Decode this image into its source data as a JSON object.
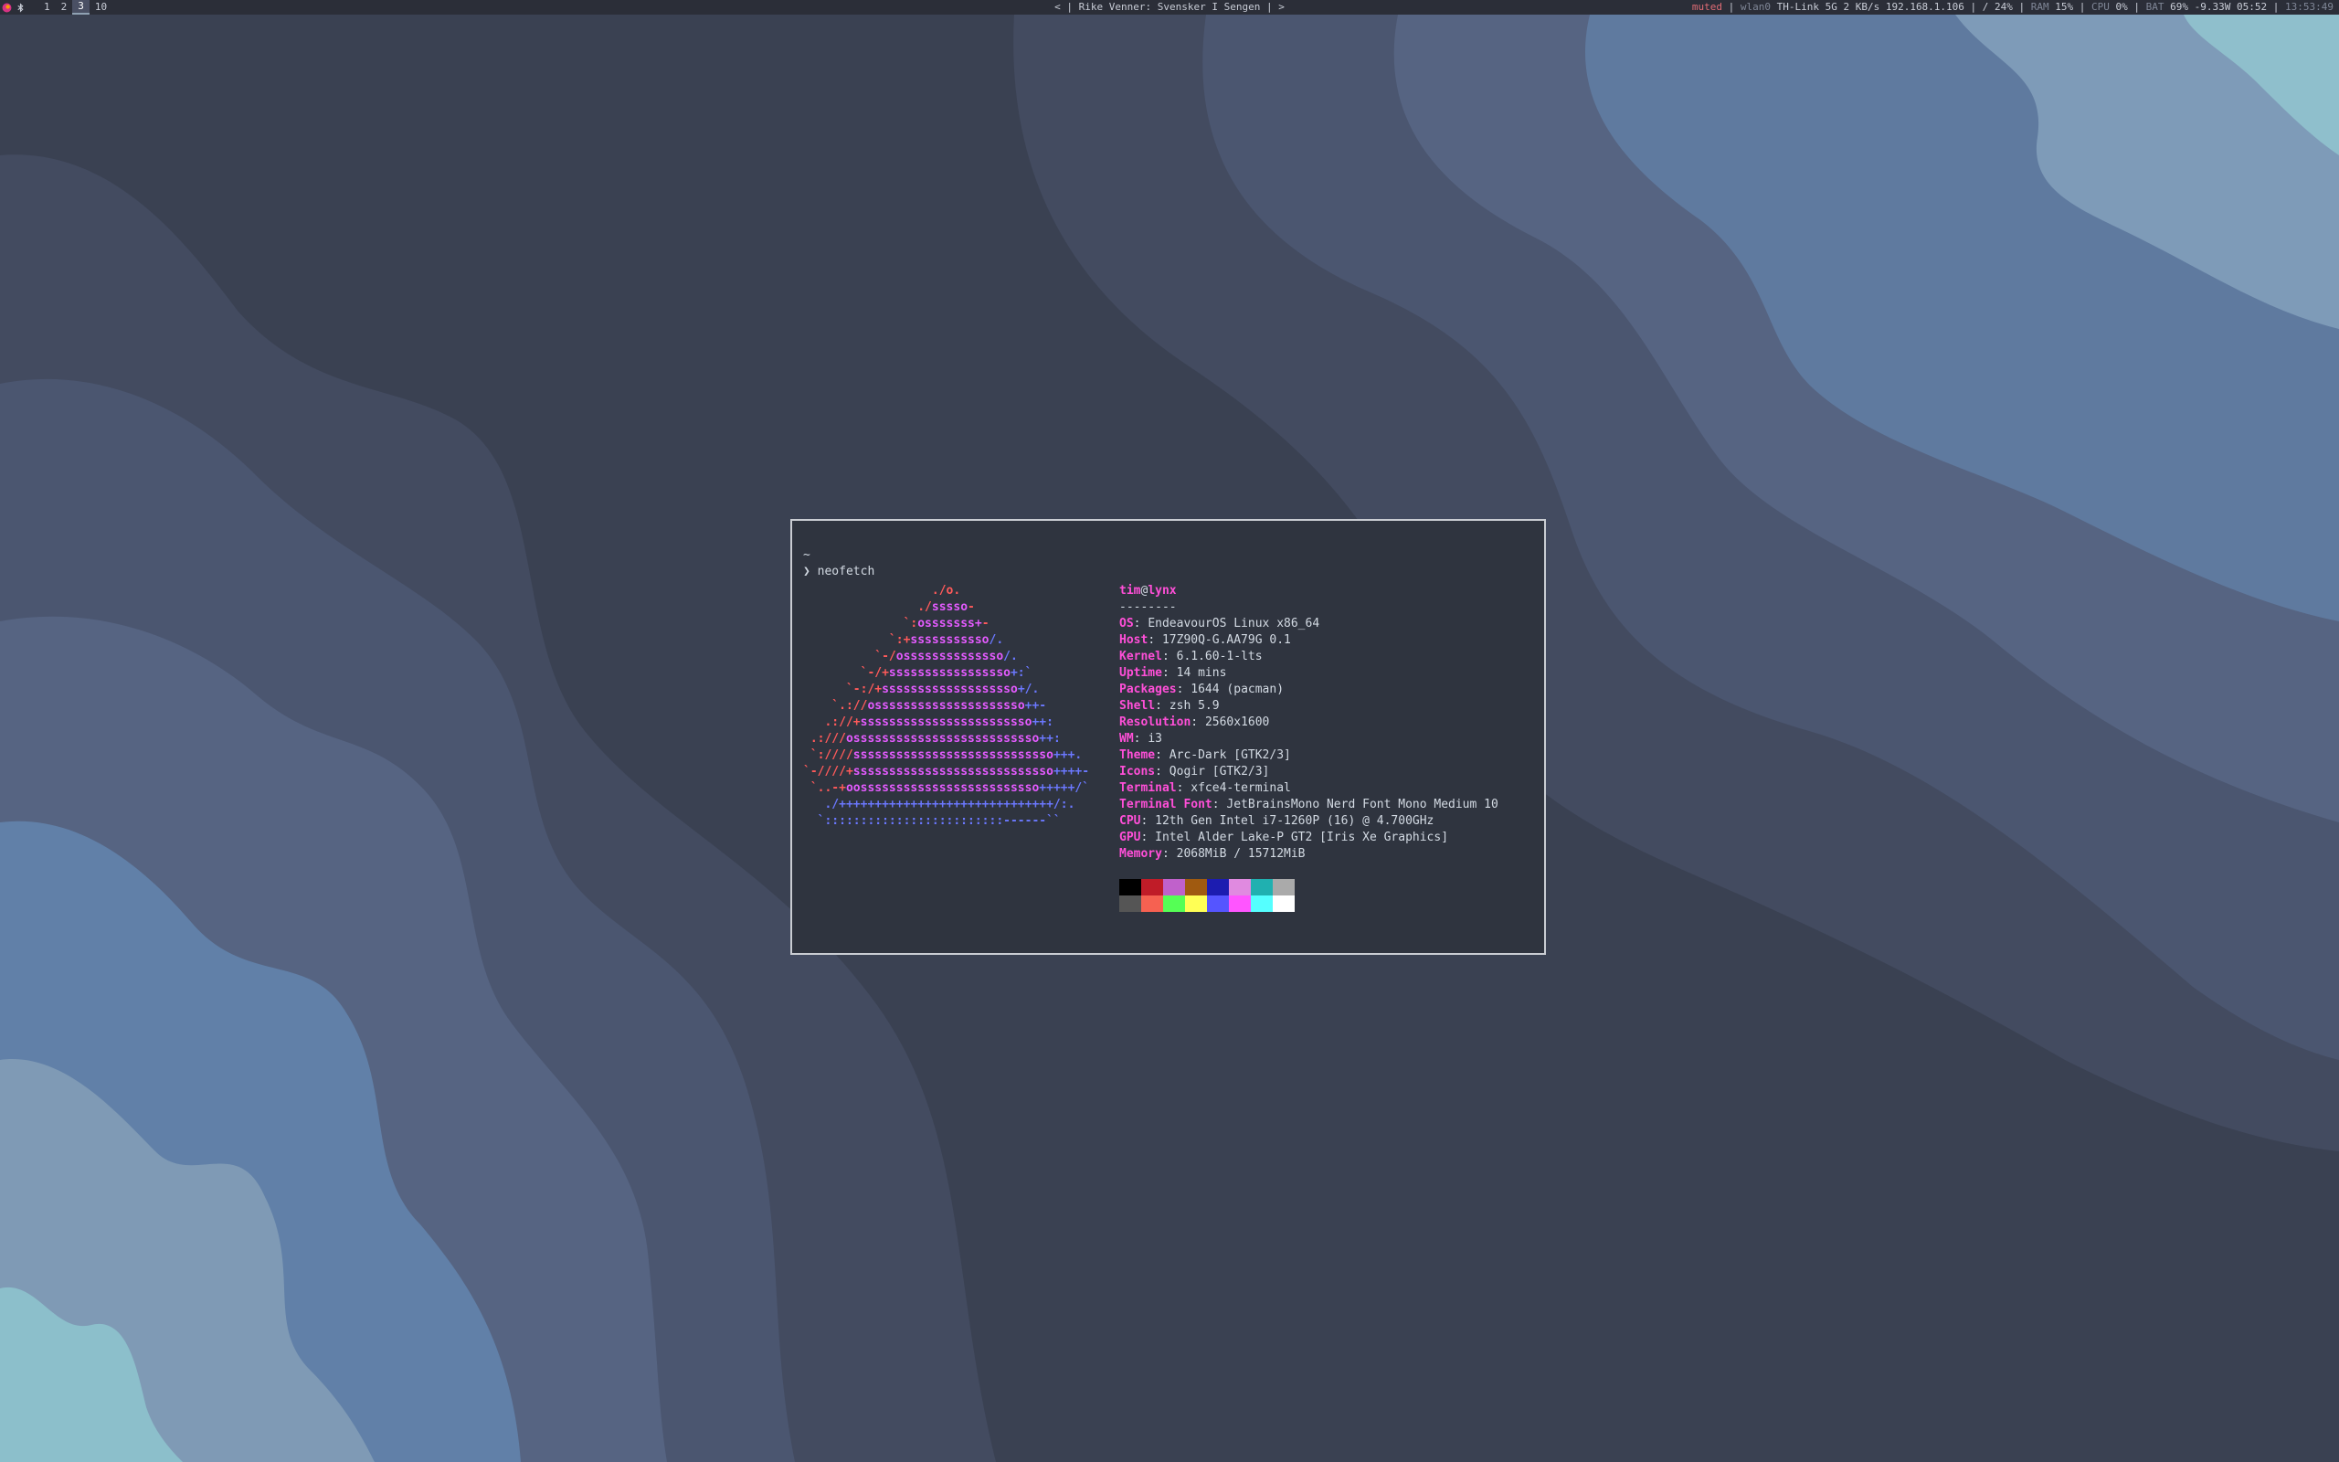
{
  "topbar": {
    "workspaces": [
      "1",
      "2",
      "3",
      "10"
    ],
    "active_workspace": "3",
    "media": "< | Rike Venner: Svensker I Sengen | >",
    "status": {
      "audio": "muted",
      "wlan_if": "wlan0",
      "ssid": "TH-Link 5G",
      "net": "2 KB/s 192.168.1.106",
      "disk": "/ 24%",
      "ram_label": "RAM",
      "ram": "15%",
      "cpu_label": "CPU",
      "cpu": "0%",
      "bat_label": "BAT",
      "bat": "69% -9.33W 05:52",
      "time": "13:53:49"
    }
  },
  "terminal": {
    "cwd": "~",
    "prompt": "❯",
    "command": "neofetch",
    "art_lines": [
      [
        [
          "red",
          "                  ./o."
        ]
      ],
      [
        [
          "red",
          "                ./"
        ],
        [
          "mag",
          "sssso"
        ],
        [
          "red",
          "-"
        ]
      ],
      [
        [
          "red",
          "              `:"
        ],
        [
          "mag",
          "osssssss+"
        ],
        [
          "red",
          "-"
        ]
      ],
      [
        [
          "red",
          "            `:+"
        ],
        [
          "mag",
          "sssssssssso"
        ],
        [
          "blue",
          "/."
        ]
      ],
      [
        [
          "red",
          "          `-/"
        ],
        [
          "mag",
          "ossssssssssssso"
        ],
        [
          "blue",
          "/."
        ]
      ],
      [
        [
          "red",
          "        `-/+"
        ],
        [
          "mag",
          "sssssssssssssssso"
        ],
        [
          "blue",
          "+:`"
        ]
      ],
      [
        [
          "red",
          "      `-:/+"
        ],
        [
          "mag",
          "sssssssssssssssssso"
        ],
        [
          "blue",
          "+/."
        ]
      ],
      [
        [
          "red",
          "    `.://"
        ],
        [
          "mag",
          "osssssssssssssssssssso"
        ],
        [
          "blue",
          "++-"
        ]
      ],
      [
        [
          "red",
          "   .://+"
        ],
        [
          "mag",
          "ssssssssssssssssssssssso"
        ],
        [
          "blue",
          "++:"
        ]
      ],
      [
        [
          "red",
          " .:///"
        ],
        [
          "mag",
          "ossssssssssssssssssssssssso"
        ],
        [
          "blue",
          "++:"
        ]
      ],
      [
        [
          "red",
          " `:////"
        ],
        [
          "mag",
          "ssssssssssssssssssssssssssso"
        ],
        [
          "blue",
          "+++."
        ]
      ],
      [
        [
          "red",
          "`-////+"
        ],
        [
          "mag",
          "ssssssssssssssssssssssssssso"
        ],
        [
          "blue",
          "++++-"
        ]
      ],
      [
        [
          "red",
          " `..-+"
        ],
        [
          "mag",
          "oosssssssssssssssssssssssso"
        ],
        [
          "blue",
          "+++++/`"
        ]
      ],
      [
        [
          "blue",
          "   ./++++++++++++++++++++++++++++++/:."
        ]
      ],
      [
        [
          "blue",
          "  `:::::::::::::::::::::::::------``"
        ]
      ]
    ],
    "user": "tim",
    "at": "@",
    "host": "lynx",
    "underline": "--------",
    "info": [
      {
        "key": "OS",
        "value": "EndeavourOS Linux x86_64"
      },
      {
        "key": "Host",
        "value": "17Z90Q-G.AA79G 0.1"
      },
      {
        "key": "Kernel",
        "value": "6.1.60-1-lts"
      },
      {
        "key": "Uptime",
        "value": "14 mins"
      },
      {
        "key": "Packages",
        "value": "1644 (pacman)"
      },
      {
        "key": "Shell",
        "value": "zsh 5.9"
      },
      {
        "key": "Resolution",
        "value": "2560x1600"
      },
      {
        "key": "WM",
        "value": "i3"
      },
      {
        "key": "Theme",
        "value": "Arc-Dark [GTK2/3]"
      },
      {
        "key": "Icons",
        "value": "Qogir [GTK2/3]"
      },
      {
        "key": "Terminal",
        "value": "xfce4-terminal"
      },
      {
        "key": "Terminal Font",
        "value": "JetBrainsMono Nerd Font Mono Medium 10"
      },
      {
        "key": "CPU",
        "value": "12th Gen Intel i7-1260P (16) @ 4.700GHz"
      },
      {
        "key": "GPU",
        "value": "Intel Alder Lake-P GT2 [Iris Xe Graphics]"
      },
      {
        "key": "Memory",
        "value": "2068MiB / 15712MiB"
      }
    ],
    "palette_normal": [
      "#000000",
      "#c01c28",
      "#c061cb",
      "#a05a10",
      "#1c1cb0",
      "#e08ae0",
      "#20b0b0",
      "#aaaaaa"
    ],
    "palette_bright": [
      "#555555",
      "#f66151",
      "#55ff55",
      "#ffff55",
      "#5555ff",
      "#ff55ff",
      "#55ffff",
      "#ffffff"
    ]
  },
  "colors": {
    "bar_bg": "#2b2e38",
    "terminal_bg": "#2f343f",
    "accent_key": "#ff4fd8",
    "wallpaper": [
      "#343a4a",
      "#3d4558",
      "#475169",
      "#52607d",
      "#5f7a9f",
      "#7e9bb8",
      "#8fbfcc"
    ]
  }
}
